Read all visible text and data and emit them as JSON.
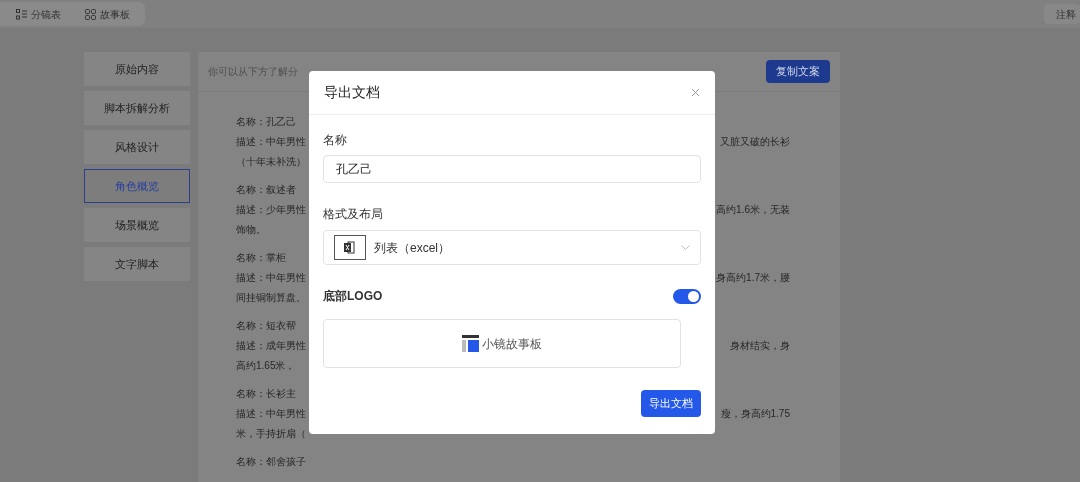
{
  "top_tabs": [
    {
      "label": "分镜表",
      "kind": "list"
    },
    {
      "label": "故事板",
      "kind": "grid"
    }
  ],
  "annotation_button": "注释",
  "nav": [
    {
      "label": "原始内容",
      "selected": false
    },
    {
      "label": "脚本拆解分析",
      "selected": false
    },
    {
      "label": "风格设计",
      "selected": false
    },
    {
      "label": "角色概览",
      "selected": true
    },
    {
      "label": "场景概览",
      "selected": false
    },
    {
      "label": "文字脚本",
      "selected": false
    }
  ],
  "hint": "你可以从下方了解分",
  "copy_button": "复制文案",
  "characters": [
    {
      "lines": [
        {
          "start": "名称：孔乙己"
        },
        {
          "start": "描述：中年男性",
          "end": "又脏又破的长衫"
        },
        {
          "start": "（十年未补洗）"
        }
      ]
    },
    {
      "lines": [
        {
          "start": "名称：叙述者"
        },
        {
          "start": "描述：少年男性",
          "end": "高约1.6米，无装"
        },
        {
          "start": "饰物。"
        }
      ]
    },
    {
      "lines": [
        {
          "start": "名称：掌柜"
        },
        {
          "start": "描述：中年男性",
          "end": "身高约1.7米，腰"
        },
        {
          "start": "间挂铜制算盘。"
        }
      ]
    },
    {
      "lines": [
        {
          "start": "名称：短衣帮"
        },
        {
          "start": "描述：成年男性",
          "end": "身材结实，身"
        },
        {
          "start": "高约1.65米，"
        }
      ]
    },
    {
      "lines": [
        {
          "start": "名称：长衫主"
        },
        {
          "start": "描述：中年男性",
          "end": "瘦，身高约1.75"
        },
        {
          "start": "米，手持折扇（"
        }
      ]
    },
    {
      "lines": [
        {
          "start": "名称：邻舍孩子"
        }
      ]
    }
  ],
  "dialog": {
    "title": "导出文档",
    "name_label": "名称",
    "name_value": "孔乙己",
    "format_label": "格式及布局",
    "format_value": "列表（excel）",
    "logo_label": "底部LOGO",
    "logo_on": true,
    "logo_text": "小镜故事板",
    "export_button": "导出文档"
  }
}
